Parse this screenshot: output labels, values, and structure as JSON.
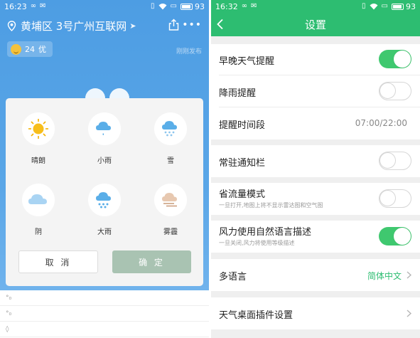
{
  "left_status": {
    "time": "16:23",
    "battery": "93",
    "icons": [
      "infinity-icon",
      "mail-icon",
      "vibrate-icon",
      "wifi-icon",
      "sim-icon",
      "battery-icon"
    ]
  },
  "location": {
    "text": "黄埔区 3号广州互联网",
    "icons": [
      "location-pin-icon",
      "locate-arrow-icon",
      "share-icon",
      "more-icon"
    ]
  },
  "aqi": {
    "value": "24",
    "level": "优"
  },
  "published": "刚刚发布",
  "weather_picker": {
    "options": [
      {
        "label": "晴朗",
        "icon": "sunny-icon"
      },
      {
        "label": "小雨",
        "icon": "light-rain-icon"
      },
      {
        "label": "雪",
        "icon": "snow-icon"
      },
      {
        "label": "阴",
        "icon": "overcast-icon"
      },
      {
        "label": "大雨",
        "icon": "heavy-rain-icon"
      },
      {
        "label": "雾霾",
        "icon": "haze-icon"
      }
    ],
    "cancel_label": "取 消",
    "confirm_label": "确 定"
  },
  "right_status": {
    "time": "16:32",
    "battery": "93"
  },
  "settings": {
    "title": "设置",
    "morning_evening": {
      "label": "早晚天气提醒",
      "enabled": true
    },
    "rain_alert": {
      "label": "降雨提醒",
      "enabled": false
    },
    "alert_period": {
      "label": "提醒时间段",
      "value": "07:00/22:00"
    },
    "notification_bar": {
      "label": "常驻通知栏",
      "enabled": false
    },
    "data_saver": {
      "label": "省流量模式",
      "desc": "一旦打开,地图上将不显示雷达图和空气图",
      "enabled": false
    },
    "natural_language": {
      "label": "风力使用自然语言描述",
      "desc": "一旦关闭,风力将使用等级描述",
      "enabled": true
    },
    "language": {
      "label": "多语言",
      "value": "简体中文"
    },
    "widget": {
      "label": "天气桌面插件设置"
    }
  },
  "colors": {
    "accent_green": "#2dbd71",
    "toggle_on": "#3fc86f",
    "confirm_button": "#a9c3b2",
    "weather_bg": "#4d9de3"
  }
}
